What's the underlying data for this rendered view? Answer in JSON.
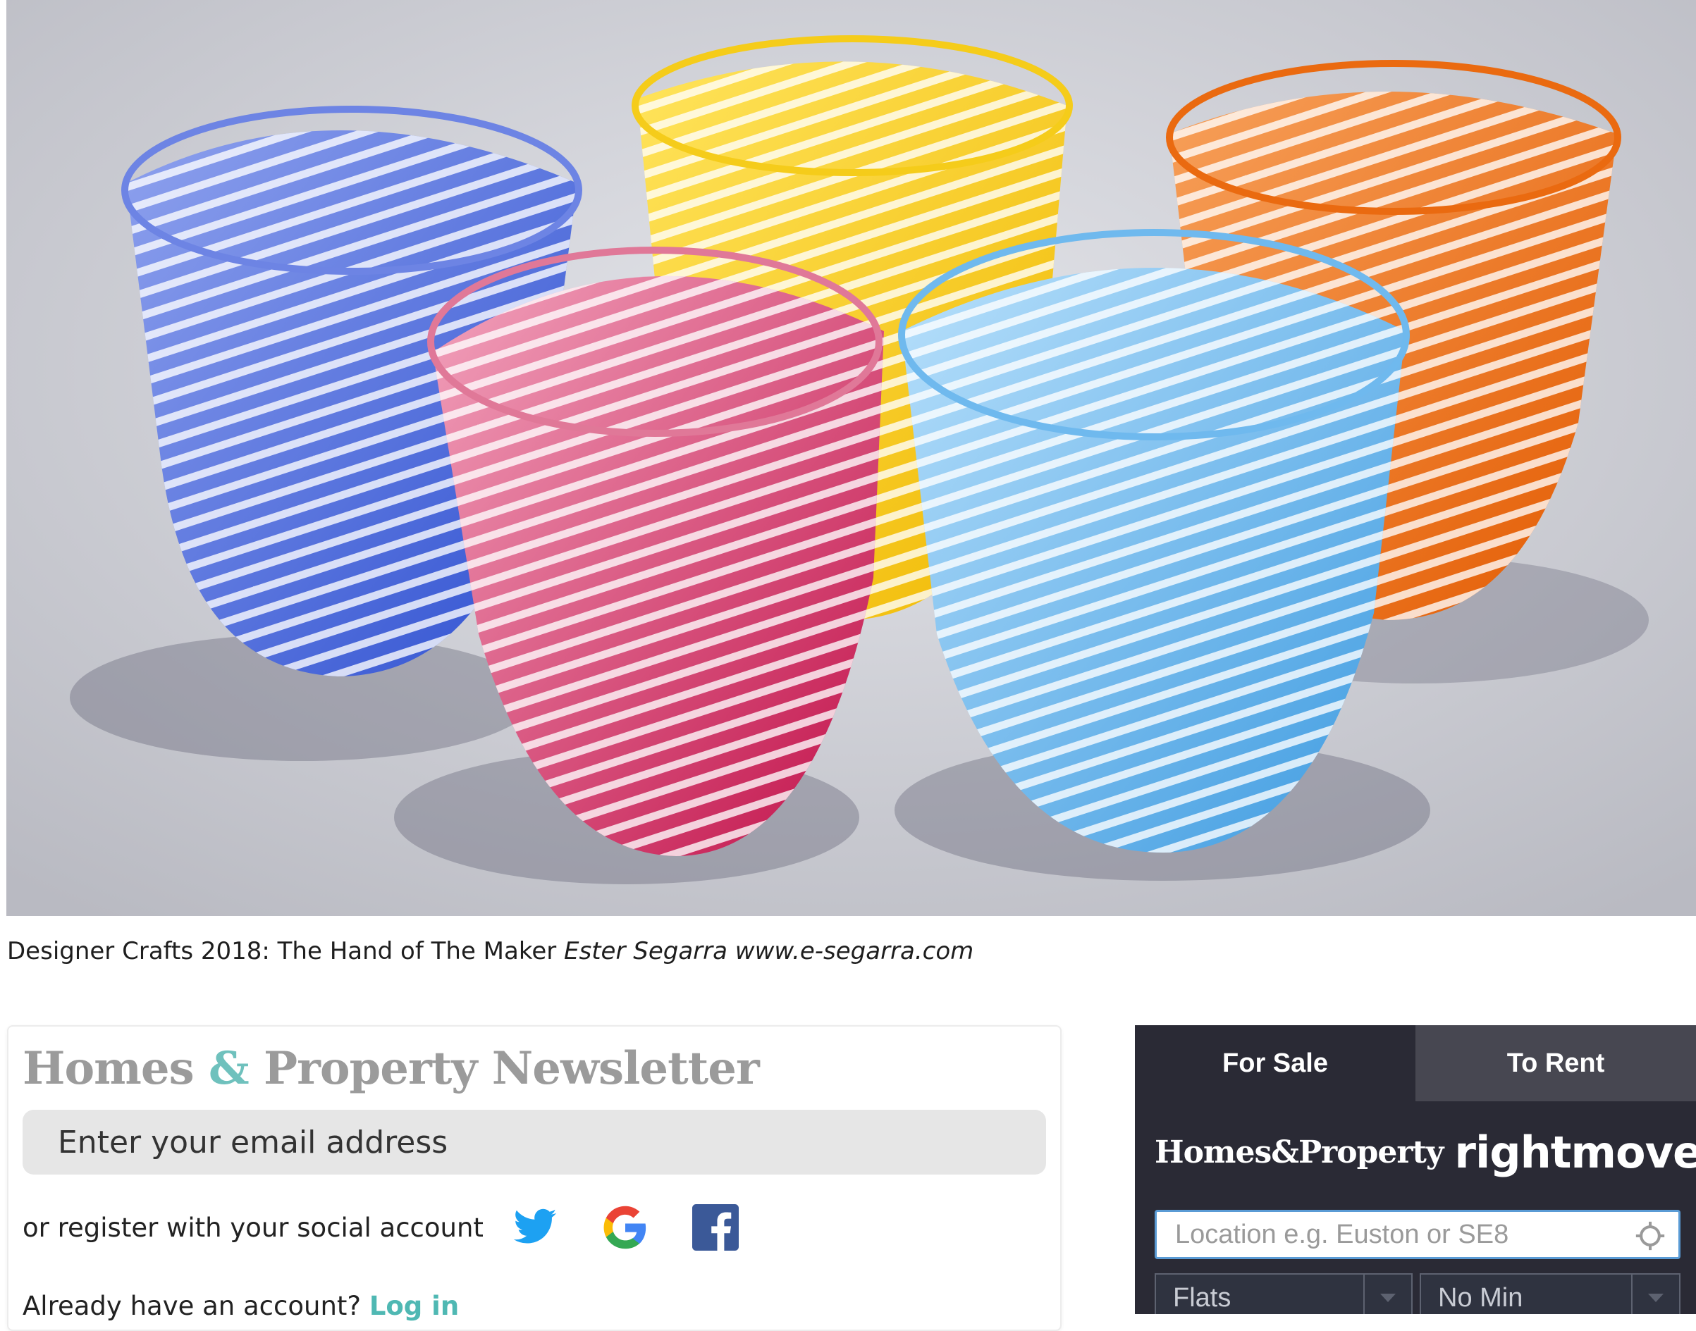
{
  "hero": {
    "alt": "Five swirled glass vessels in blue, yellow, orange, pink and light blue",
    "colors": [
      "#3f5fd6",
      "#f2c500",
      "#ea6a10",
      "#d0134f",
      "#5aaee8"
    ]
  },
  "caption": {
    "text": "Designer Crafts 2018: The Hand of The Maker ",
    "credit": "Ester Segarra www.e-segarra.com"
  },
  "newsletter": {
    "title_part1": "Homes",
    "title_amp": "&",
    "title_part2": "Property Newsletter",
    "email_placeholder": "Enter your email address",
    "social_label": "or register with your social account",
    "social": [
      {
        "name": "twitter-icon",
        "color": "#1da1f2"
      },
      {
        "name": "google-icon",
        "color": "#4285f4"
      },
      {
        "name": "facebook-icon",
        "color": "#3b5998"
      }
    ],
    "login_prompt": "Already have an account? ",
    "login_link": "Log in",
    "accent_color": "#4fb8b3"
  },
  "search": {
    "tabs": [
      "For Sale",
      "To Rent"
    ],
    "brand_left": "Homes&Property",
    "brand_right": "rightmove",
    "brand_accent": "#4fd1c5",
    "location_placeholder": "Location e.g. Euston or SE8",
    "property_type": "Flats",
    "min_price": "No Min"
  }
}
